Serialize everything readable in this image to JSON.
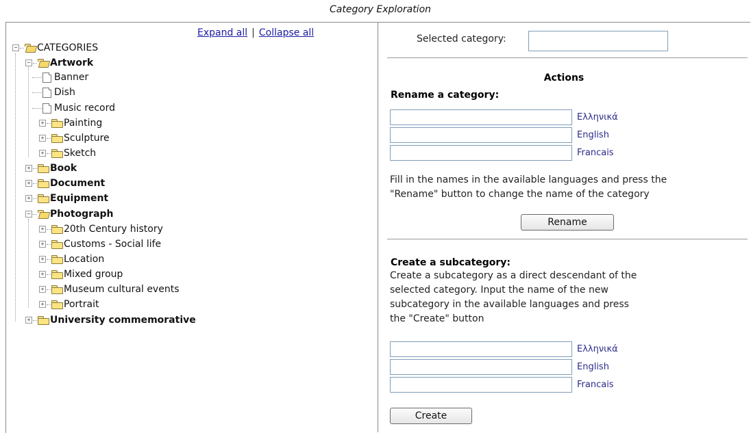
{
  "page": {
    "title": "Category Exploration"
  },
  "tree_links": {
    "expand_all": "Expand all",
    "separator": "|",
    "collapse_all": "Collapse all"
  },
  "tree": {
    "root": "CATEGORIES",
    "artwork": "Artwork",
    "artwork_children": [
      "Banner",
      "Dish",
      "Music record",
      "Painting",
      "Sculpture",
      "Sketch"
    ],
    "book": "Book",
    "document": "Document",
    "equipment": "Equipment",
    "photograph": "Photograph",
    "photograph_children": [
      "20th Century history",
      "Customs - Social life",
      "Location",
      "Mixed group",
      "Museum cultural events",
      "Portrait"
    ],
    "university": "University commemorative"
  },
  "selected": {
    "label": "Selected category:",
    "value": ""
  },
  "actions": {
    "title": "Actions"
  },
  "rename": {
    "heading": "Rename a category:",
    "languages": [
      "Ελληνικά",
      "English",
      "Francais"
    ],
    "description_line1": "Fill in the names in the available languages and press the",
    "description_line2": "\"Rename\" button to change the name of the category",
    "button": "Rename"
  },
  "create": {
    "heading": "Create a subcategory:",
    "description_line1": "Create a subcategory as a direct descendant of the",
    "description_line2": "selected category. Input the name of the new",
    "description_line3": "subcategory in the available languages and press",
    "description_line4": "the \"Create\" button",
    "languages": [
      "Ελληνικά",
      "English",
      "Francais"
    ],
    "button": "Create"
  }
}
